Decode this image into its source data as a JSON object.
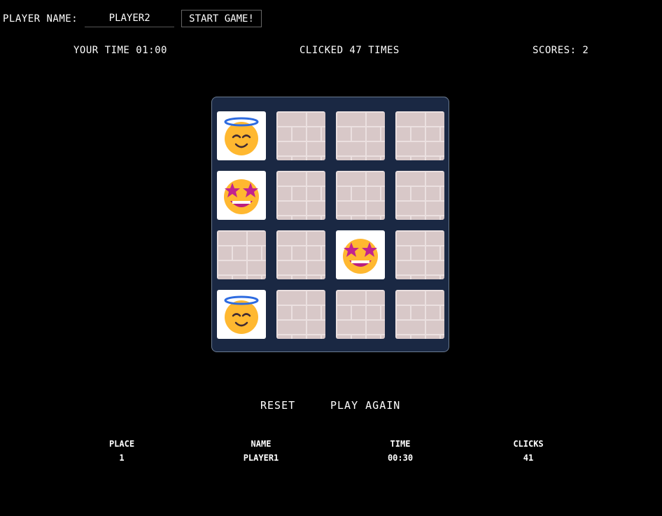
{
  "header": {
    "player_label": "PLAYER NAME:",
    "player_value": "PLAYER2",
    "start_label": "START GAME!"
  },
  "stats": {
    "time": "YOUR TIME 01:00",
    "clicks": "CLICKED 47 TIMES",
    "scores": "SCORES: 2"
  },
  "board": {
    "cards": [
      {
        "state": "face",
        "emoji": "smiling-face-with-halo-icon"
      },
      {
        "state": "back"
      },
      {
        "state": "back"
      },
      {
        "state": "back"
      },
      {
        "state": "face",
        "emoji": "star-struck-icon"
      },
      {
        "state": "back"
      },
      {
        "state": "back"
      },
      {
        "state": "back"
      },
      {
        "state": "back"
      },
      {
        "state": "back"
      },
      {
        "state": "face",
        "emoji": "star-struck-icon"
      },
      {
        "state": "back"
      },
      {
        "state": "face",
        "emoji": "smiling-face-with-halo-icon"
      },
      {
        "state": "back"
      },
      {
        "state": "back"
      },
      {
        "state": "back"
      }
    ]
  },
  "actions": {
    "reset": "RESET",
    "play_again": "PLAY AGAIN"
  },
  "leaderboard": {
    "headers": [
      "PLACE",
      "NAME",
      "TIME",
      "CLICKS"
    ],
    "rows": [
      [
        "1",
        "PLAYER1",
        "00:30",
        "41"
      ]
    ]
  }
}
